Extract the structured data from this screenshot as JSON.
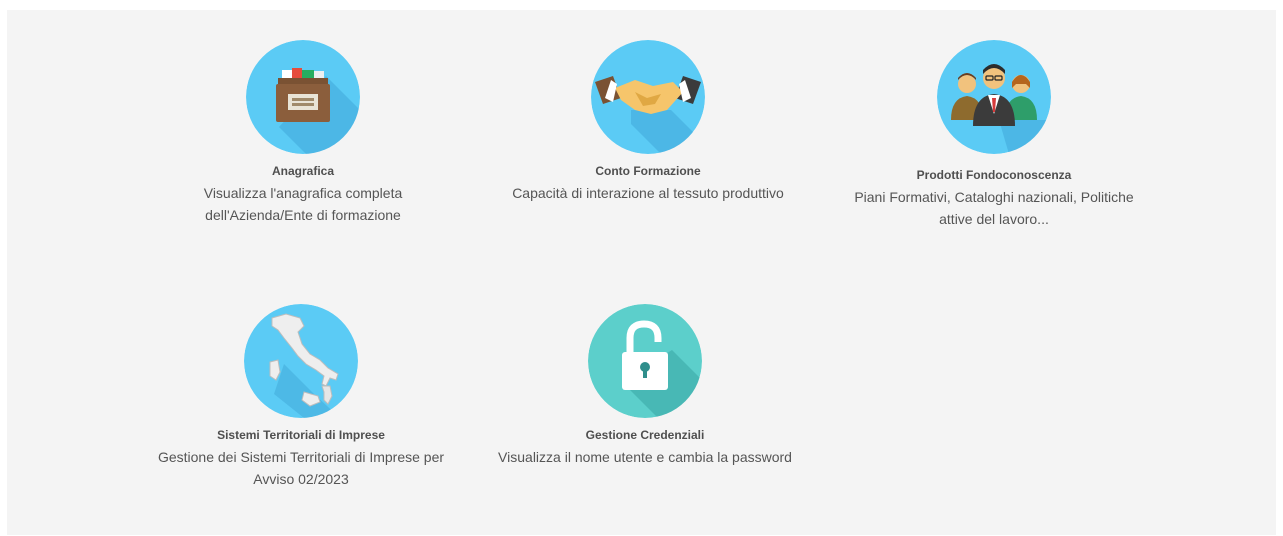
{
  "tiles": {
    "anagrafica": {
      "title": "Anagrafica",
      "desc_line1": "Visualizza l'anagrafica completa",
      "desc_line2": "dell'Azienda/Ente di formazione",
      "icon": "archive-box-icon"
    },
    "conto": {
      "title": "Conto Formazione",
      "desc_line1": "Capacità di interazione al tessuto produttivo",
      "icon": "handshake-icon"
    },
    "prodotti": {
      "title": "Prodotti Fondoconoscenza",
      "desc_line1": "Piani Formativi, Cataloghi nazionali, Politiche",
      "desc_line2": "attive del lavoro...",
      "icon": "people-group-icon"
    },
    "sistemi": {
      "title": "Sistemi Territoriali di Imprese",
      "desc_line1": "Gestione dei Sistemi Territoriali di Imprese per",
      "desc_line2": "Avviso 02/2023",
      "icon": "italy-map-icon"
    },
    "credenziali": {
      "title": "Gestione Credenziali",
      "desc_line1": "Visualizza il nome utente e cambia la password",
      "icon": "padlock-icon"
    }
  },
  "colors": {
    "panel_bg": "#f4f4f4",
    "circle_blue": "#5bcbf5",
    "circle_teal": "#5ccfcb",
    "title_text": "#4f4f4f",
    "desc_text": "#555555"
  }
}
